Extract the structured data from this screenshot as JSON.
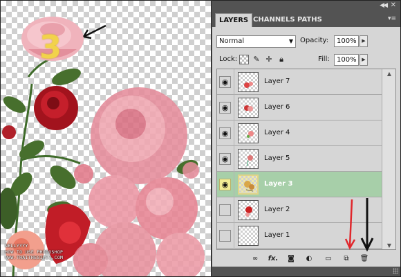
{
  "annotation": {
    "step_number": "3",
    "credit_lines": [
      "NELLYYYY",
      "HOW TO USE PHOTOSHOP",
      "WWW.THAITHESIMS3.COM"
    ]
  },
  "panel": {
    "tabs": [
      {
        "label": "LAYERS",
        "active": true
      },
      {
        "label": "CHANNELS",
        "active": false
      },
      {
        "label": "PATHS",
        "active": false
      }
    ],
    "blend_mode": "Normal",
    "opacity_label": "Opacity:",
    "opacity_value": "100%",
    "lock_label": "Lock:",
    "fill_label": "Fill:",
    "fill_value": "100%",
    "layers": [
      {
        "name": "Layer 7",
        "visible": true,
        "selected": false
      },
      {
        "name": "Layer 6",
        "visible": true,
        "selected": false
      },
      {
        "name": "Layer 4",
        "visible": true,
        "selected": false
      },
      {
        "name": "Layer 5",
        "visible": true,
        "selected": false
      },
      {
        "name": "Layer 3",
        "visible": true,
        "selected": true
      },
      {
        "name": "Layer 2",
        "visible": false,
        "selected": false
      },
      {
        "name": "Layer 1",
        "visible": false,
        "selected": false
      }
    ],
    "footer_icons": [
      "link-layers-icon",
      "fx-icon",
      "layer-mask-icon",
      "adjustment-layer-icon",
      "new-group-icon",
      "new-layer-icon",
      "trash-icon"
    ],
    "fx_label": "fx."
  },
  "colors": {
    "panel_bg": "#d6d6d6",
    "panel_dark": "#535353",
    "selected_row": "#a7cfa9",
    "red_arrow": "#e0272c",
    "black_arrow": "#111111"
  }
}
